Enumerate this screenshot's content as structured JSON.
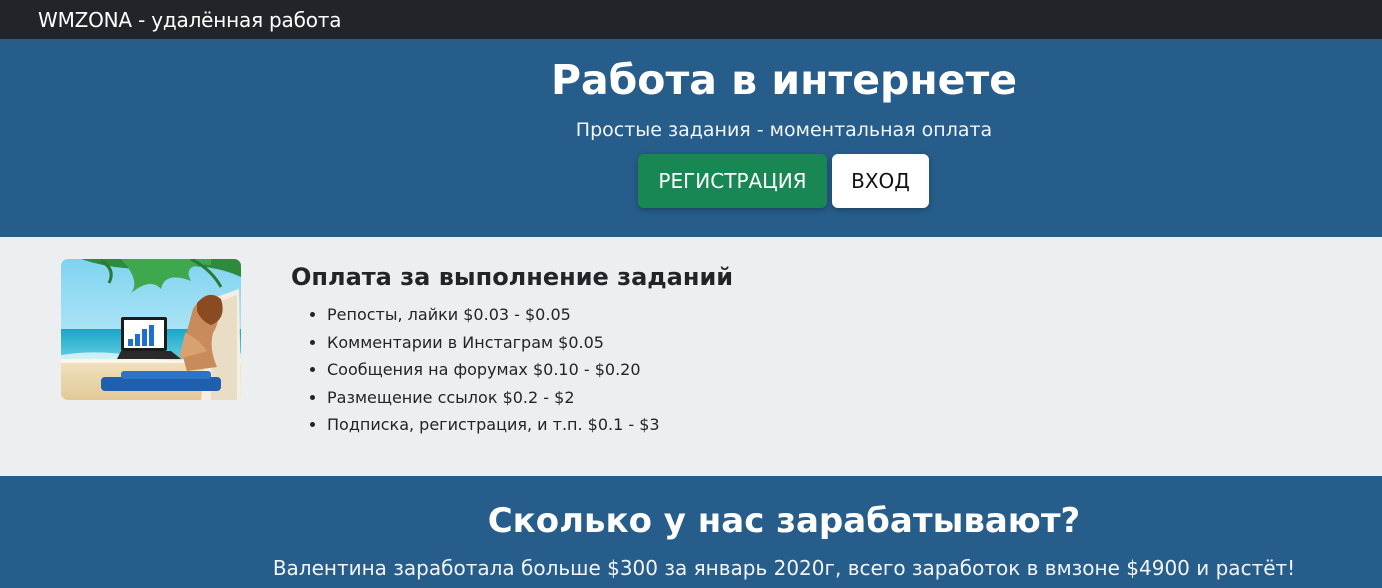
{
  "navbar": {
    "brand": "WMZONA - удалённая работа"
  },
  "hero": {
    "title": "Работа в интернете",
    "subtitle": "Простые задания - моментальная оплата",
    "register_label": "РЕГИСТРАЦИЯ",
    "login_label": "ВХОД"
  },
  "features": {
    "image": "beach-laptop-photo",
    "title": "Оплата за выполнение заданий",
    "items": [
      "Репосты, лайки $0.03 - $0.05",
      "Комментарии в Инстаграм $0.05",
      "Сообщения на форумах $0.10 - $0.20",
      "Размещение ссылок $0.2 - $2",
      "Подписка, регистрация, и т.п. $0.1 - $3"
    ]
  },
  "earnings": {
    "title": "Сколько у нас зарабатывают?",
    "text": "Валентина заработала больше $300 за январь 2020г, всего заработок в вмзоне $4900 и растёт!"
  },
  "colors": {
    "navbar": "#212529",
    "hero_bg": "#275d8b",
    "register_button": "#198754",
    "features_bg": "#eceeef"
  }
}
